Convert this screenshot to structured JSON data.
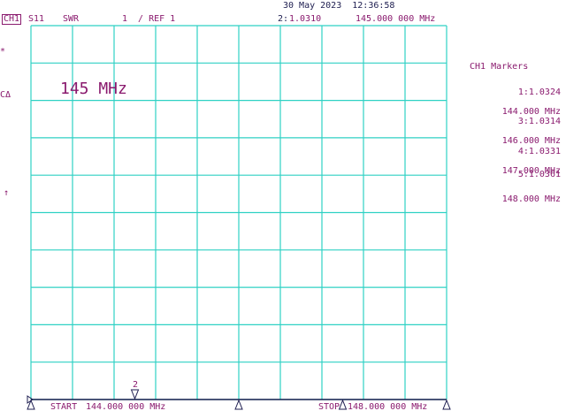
{
  "header": {
    "channel": "CH1",
    "param": "S11",
    "format": "SWR",
    "scale": "1  / REF 1",
    "datetime": "30 May 2023  12:36:58",
    "active_marker_index": "2:",
    "active_marker_value": "1.0310",
    "active_marker_freq": "145.000 000 MHz"
  },
  "left_indicators": {
    "star": "*",
    "cal": "CΔ",
    "arrow": "↑"
  },
  "annotation": "145 MHz",
  "marker_panel": {
    "title": "CH1 Markers",
    "markers": [
      {
        "id": "1:",
        "value": "1.0324",
        "freq": "144.000 MHz"
      },
      {
        "id": "3:",
        "value": "1.0314",
        "freq": "146.000 MHz"
      },
      {
        "id": "4:",
        "value": "1.0331",
        "freq": "147.000 MHz"
      },
      {
        "id": "5:",
        "value": "1.0361",
        "freq": "148.000 MHz"
      }
    ]
  },
  "footer": {
    "start_label": "START",
    "start_freq": "144.000 000 MHz",
    "stop_label": "STOP",
    "stop_freq": "148.000 000 MHz"
  },
  "bottom_marker_number": "2",
  "grid": {
    "columns": 10,
    "rows": 10,
    "color": "#2fd1c4"
  },
  "trace": {
    "color": "#1e1e50"
  },
  "colors": {
    "label": "#8a1a6e",
    "dark_text": "#1e1e50",
    "background": "#ffffff"
  }
}
